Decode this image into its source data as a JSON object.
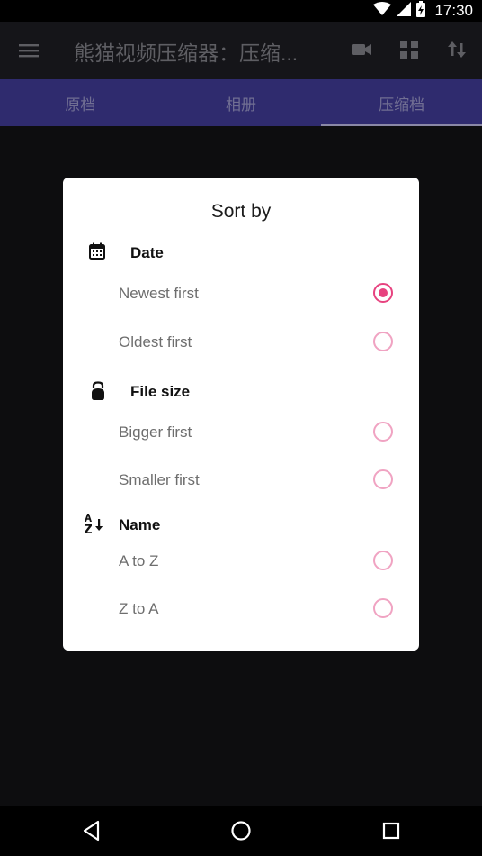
{
  "status_bar": {
    "time": "17:30"
  },
  "app_bar": {
    "title": "熊猫视频压缩器：压缩..."
  },
  "tabs": [
    {
      "label": "原档",
      "active": false
    },
    {
      "label": "相册",
      "active": false
    },
    {
      "label": "压缩档",
      "active": true
    }
  ],
  "dialog": {
    "title": "Sort by",
    "sections": [
      {
        "label": "Date",
        "icon": "calendar-icon",
        "options": [
          {
            "label": "Newest first",
            "checked": true
          },
          {
            "label": "Oldest first",
            "checked": false
          }
        ]
      },
      {
        "label": "File size",
        "icon": "kettlebell-icon",
        "options": [
          {
            "label": "Bigger first",
            "checked": false
          },
          {
            "label": "Smaller first",
            "checked": false
          }
        ]
      },
      {
        "label": "Name",
        "icon": "sort-alpha-icon",
        "options": [
          {
            "label": "A to Z",
            "checked": false
          },
          {
            "label": "Z to A",
            "checked": false
          }
        ]
      }
    ]
  },
  "colors": {
    "accent": "#e7427f",
    "tab_bar": "#2f2b6e",
    "app_bar": "#151519",
    "background": "#0d0d0f"
  }
}
